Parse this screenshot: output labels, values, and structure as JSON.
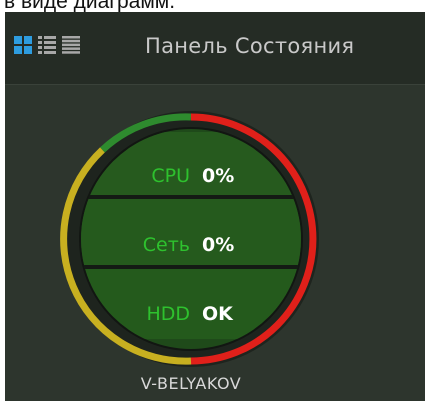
{
  "caption": {
    "text": "в виде диаграмм."
  },
  "toolbar": {
    "icons": [
      "grid-view-icon",
      "list-view-icon",
      "detailed-list-view-icon"
    ],
    "title": "Панель Состояния"
  },
  "device": {
    "name": "V-BELYAKOV",
    "metrics": [
      {
        "label": "CPU",
        "value": "0%"
      },
      {
        "label": "Сеть",
        "value": "0%"
      },
      {
        "label": "HDD",
        "value": "OK"
      }
    ],
    "ring_segments": [
      {
        "status": "ok",
        "color": "#2e8b2e"
      },
      {
        "status": "error",
        "color": "#e0201a"
      },
      {
        "status": "warning",
        "color": "#c8b020"
      }
    ]
  },
  "colors": {
    "panel_bg": "#2b332b",
    "metric_label": "#2ec12e",
    "metric_value": "#ffffff",
    "icon_active": "#2e9de0",
    "icon_inactive": "#a8a8a8"
  }
}
